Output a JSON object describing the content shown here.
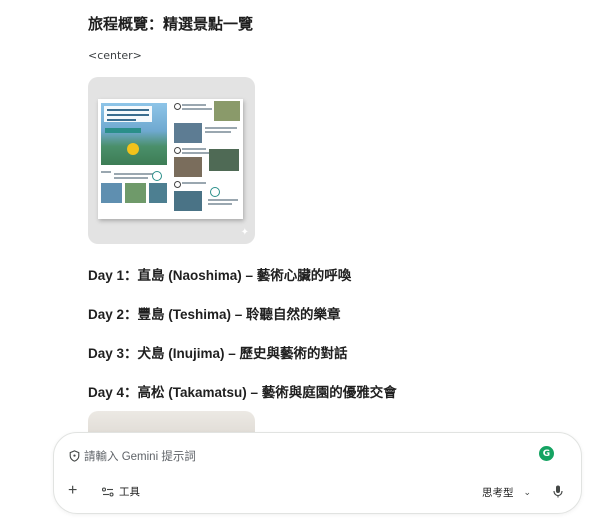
{
  "message": {
    "heading": "旅程概覽：精選景點一覽",
    "raw_tag": "<center>",
    "days": [
      "Day 1：直島 (Naoshima) – 藝術心臟的呼喚",
      "Day 2：豐島 (Teshima) – 聆聽自然的樂章",
      "Day 3：犬島 (Inujima) – 歷史與藝術的對話",
      "Day 4：高松 (Takamatsu) – 藝術與庭園的優雅交會"
    ]
  },
  "composer": {
    "placeholder": "請輸入 Gemini 提示詞",
    "tools_label": "工具",
    "model_label": "思考型",
    "grammar_badge": "G"
  },
  "icons": {
    "privacy": "shield-icon",
    "grammar": "grammarly-icon",
    "add": "plus-icon",
    "tools": "tools-icon",
    "dropdown": "chevron-down-icon",
    "mic": "microphone-icon",
    "sparkle": "sparkle-icon"
  },
  "colors": {
    "text": "#1f1f1f",
    "image_bg": "#e3e3e3",
    "grammar_badge": "#15a362",
    "border": "#e1e3e1"
  }
}
